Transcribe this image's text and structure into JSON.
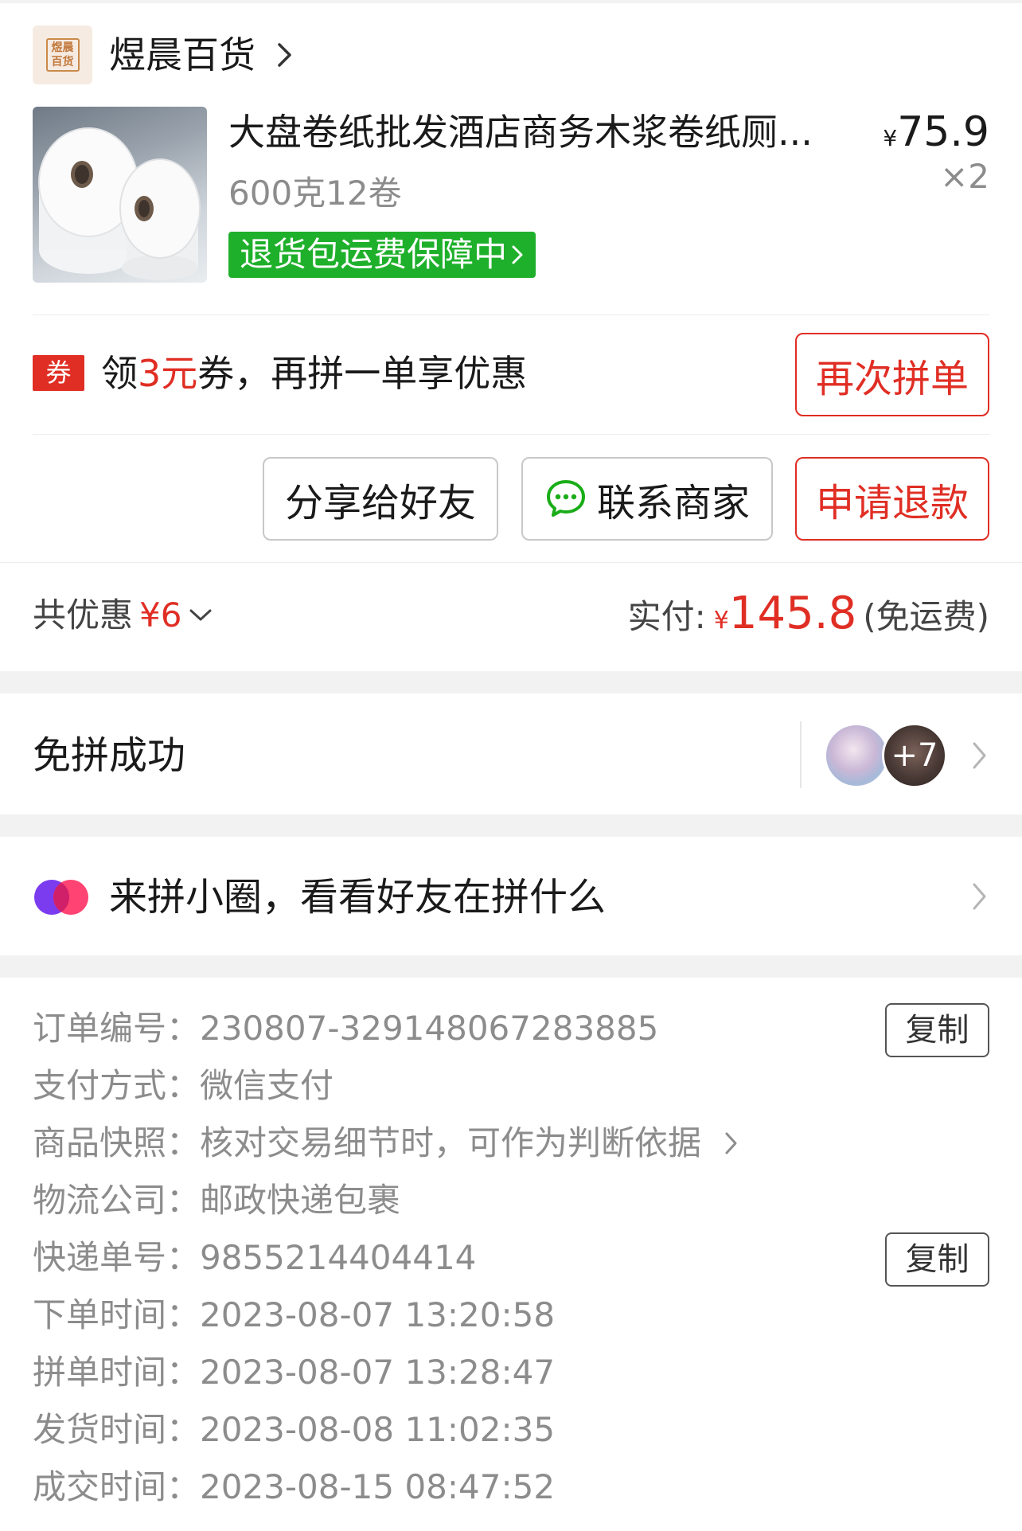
{
  "store": {
    "logo_text_line1": "煜晨",
    "logo_text_line2": "百货",
    "name": "煜晨百货"
  },
  "product": {
    "title": "大盘卷纸批发酒店商务木浆卷纸厕...",
    "price_symbol": "¥",
    "price": "75.9",
    "quantity": "×2",
    "spec": "600克12卷",
    "return_badge": "退货包运费保障中"
  },
  "coupon": {
    "tag": "券",
    "text_prefix": "领",
    "text_amount": "3元",
    "text_suffix": "券，再拼一单享优惠",
    "reorder_button": "再次拼单"
  },
  "actions": {
    "share_button": "分享给好友",
    "contact_button": "联系商家",
    "refund_button": "申请退款"
  },
  "summary": {
    "discount_label": "共优惠",
    "discount_amount": "¥6",
    "paid_label": "实付:",
    "paid_symbol": "¥",
    "paid_amount": "145.8",
    "shipping_note": "(免运费)"
  },
  "group": {
    "status": "免拼成功",
    "extra_members": "+7"
  },
  "circle": {
    "text": "来拼小圈，看看好友在拼什么"
  },
  "order_info": {
    "copy_label": "复制",
    "rows": [
      {
        "label": "订单编号：",
        "value": "230807-329148067283885"
      },
      {
        "label": "支付方式：",
        "value": "微信支付"
      },
      {
        "label": "商品快照：",
        "value": "核对交易细节时，可作为判断依据"
      },
      {
        "label": "物流公司：",
        "value": "邮政快递包裹"
      },
      {
        "label": "快递单号：",
        "value": "9855214404414"
      },
      {
        "label": "下单时间：",
        "value": "2023-08-07 13:20:58"
      },
      {
        "label": "拼单时间：",
        "value": "2023-08-07 13:28:47"
      },
      {
        "label": "发货时间：",
        "value": "2023-08-08 11:02:35"
      },
      {
        "label": "成交时间：",
        "value": "2023-08-15 08:47:52"
      }
    ]
  },
  "colors": {
    "accent_red": "#e02e24",
    "badge_green": "#1fb02b",
    "wechat_green": "#1aad19"
  }
}
